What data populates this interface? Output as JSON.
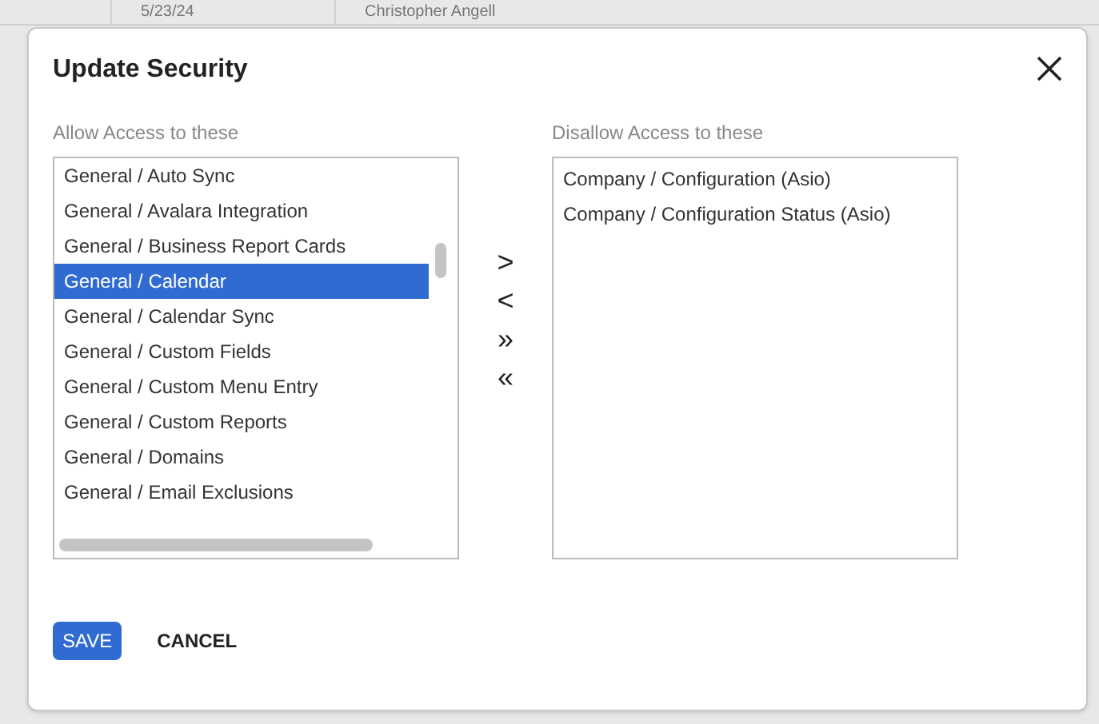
{
  "background_table": {
    "row": [
      "5/23/24",
      "Christopher Angell"
    ]
  },
  "dialog": {
    "title": "Update Security",
    "allow_list": {
      "label": "Allow Access to these",
      "items": [
        {
          "text": "General / Auto Sync",
          "selected": false
        },
        {
          "text": "General / Avalara Integration",
          "selected": false
        },
        {
          "text": "General / Business Report Cards",
          "selected": false
        },
        {
          "text": "General / Calendar",
          "selected": true
        },
        {
          "text": "General / Calendar Sync",
          "selected": false
        },
        {
          "text": "General / Custom Fields",
          "selected": false
        },
        {
          "text": "General / Custom Menu Entry",
          "selected": false
        },
        {
          "text": "General / Custom Reports",
          "selected": false
        },
        {
          "text": "General / Domains",
          "selected": false
        },
        {
          "text": "General / Email Exclusions",
          "selected": false
        }
      ]
    },
    "move_buttons": [
      ">",
      "<",
      "»",
      "«"
    ],
    "disallow_list": {
      "label": "Disallow Access to these",
      "items": [
        {
          "text": "Company / Configuration (Asio)",
          "selected": false
        },
        {
          "text": "Company / Configuration Status (Asio)",
          "selected": false
        }
      ]
    },
    "buttons": [
      {
        "label": "SAVE",
        "kind": "primary"
      },
      {
        "label": "CANCEL",
        "kind": "text"
      }
    ]
  }
}
